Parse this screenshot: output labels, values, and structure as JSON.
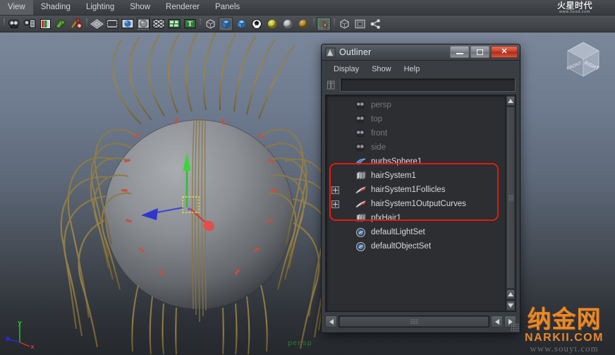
{
  "app": {
    "menubar": {
      "items": [
        {
          "label": "View"
        },
        {
          "label": "Shading"
        },
        {
          "label": "Lighting"
        },
        {
          "label": "Show"
        },
        {
          "label": "Renderer"
        },
        {
          "label": "Panels"
        }
      ]
    },
    "brand": {
      "mark": "火星时代",
      "url": "www.hxsd.com"
    },
    "toolbar": {
      "groups": [
        {
          "icons": [
            {
              "name": "camera-icon",
              "tip": "Select camera"
            },
            {
              "name": "camera-attributes-icon",
              "tip": "Camera attributes"
            },
            {
              "name": "book-icon",
              "tip": "Book"
            },
            {
              "name": "paint-icon",
              "tip": "Paint effects"
            },
            {
              "name": "brush-add-icon",
              "tip": "Add brush"
            }
          ]
        },
        {
          "icons": [
            {
              "name": "wireframe-icon",
              "tip": "Wireframe"
            },
            {
              "name": "film-icon",
              "tip": "Film gate"
            },
            {
              "name": "smooth-shade-icon",
              "tip": "Smooth shade all"
            },
            {
              "name": "shaded-sphere-icon",
              "tip": "Shaded display",
              "pressed": true
            },
            {
              "name": "texture-icon",
              "tip": "Hardware texturing"
            },
            {
              "name": "xray-icon",
              "tip": "X-Ray"
            },
            {
              "name": "text-icon",
              "tip": "Text"
            }
          ]
        },
        {
          "icons": [
            {
              "name": "cube-wireframe-icon",
              "tip": "Wireframe cube"
            },
            {
              "name": "cube-shaded-icon",
              "tip": "Shaded cube",
              "pressed": true
            },
            {
              "name": "cube-textured-icon",
              "tip": "Textured cube"
            },
            {
              "name": "checker-sphere-icon",
              "tip": "Checker"
            },
            {
              "name": "light-yellow-icon",
              "tip": "Default light"
            },
            {
              "name": "light-gray-icon",
              "tip": "All lights"
            },
            {
              "name": "light-amber-icon",
              "tip": "Shadows"
            }
          ]
        },
        {
          "icons": [
            {
              "name": "marquee-select-icon",
              "tip": "Marquee select",
              "pressed": true
            }
          ]
        },
        {
          "icons": [
            {
              "name": "isolate-cube-icon",
              "tip": "Isolate select"
            },
            {
              "name": "frame-icon",
              "tip": "Frame"
            },
            {
              "name": "share-icon",
              "tip": "Share"
            }
          ]
        }
      ]
    }
  },
  "viewport": {
    "camera_label": "persp",
    "axis_gizmo": {
      "y_label": "y",
      "x_label": "x",
      "y_color": "#24c024",
      "x_color": "#cc2a2a",
      "z_color": "#2a2ad0"
    },
    "viewcube": {
      "front_face_label": "RIGHT",
      "side_face_label": "FRONT"
    },
    "scene": {
      "object": "nurbsSphere1 with hair system",
      "sphere_color": "#8a8d92",
      "hair_color": "#9c8349",
      "manipulator": "move-tool"
    },
    "watermark": {
      "cn": "纳金网",
      "en": "NARKII.COM",
      "sub": "www.souyt.com"
    }
  },
  "outliner": {
    "title": "Outliner",
    "window_buttons": {
      "minimize": "–",
      "maximize": "□",
      "close": "✕"
    },
    "menus": [
      {
        "label": "Display"
      },
      {
        "label": "Show"
      },
      {
        "label": "Help"
      }
    ],
    "search": {
      "value": "",
      "placeholder": ""
    },
    "items": [
      {
        "label": "persp",
        "icon": "camera-icon",
        "dim": true,
        "expand": false,
        "indent": false,
        "highlighted": false
      },
      {
        "label": "top",
        "icon": "camera-icon",
        "dim": true,
        "expand": false,
        "indent": false,
        "highlighted": false
      },
      {
        "label": "front",
        "icon": "camera-icon",
        "dim": true,
        "expand": false,
        "indent": false,
        "highlighted": false
      },
      {
        "label": "side",
        "icon": "camera-icon",
        "dim": true,
        "expand": false,
        "indent": false,
        "highlighted": false
      },
      {
        "label": "nurbsSphere1",
        "icon": "nurbs-surface-icon",
        "dim": false,
        "expand": false,
        "indent": false,
        "highlighted": false
      },
      {
        "label": "hairSystem1",
        "icon": "hair-system-icon",
        "dim": false,
        "expand": false,
        "indent": false,
        "highlighted": true
      },
      {
        "label": "hairSystem1Follicles",
        "icon": "follicle-group-icon",
        "dim": false,
        "expand": true,
        "indent": false,
        "highlighted": true
      },
      {
        "label": "hairSystem1OutputCurves",
        "icon": "follicle-group-icon",
        "dim": false,
        "expand": true,
        "indent": false,
        "highlighted": true
      },
      {
        "label": "pfxHair1",
        "icon": "hair-system-icon",
        "dim": false,
        "expand": false,
        "indent": false,
        "highlighted": true
      },
      {
        "label": "defaultLightSet",
        "icon": "set-icon",
        "dim": false,
        "expand": false,
        "indent": false,
        "highlighted": false
      },
      {
        "label": "defaultObjectSet",
        "icon": "set-icon",
        "dim": false,
        "expand": false,
        "indent": false,
        "highlighted": false
      }
    ],
    "highlight_box_color": "#e01b14"
  }
}
